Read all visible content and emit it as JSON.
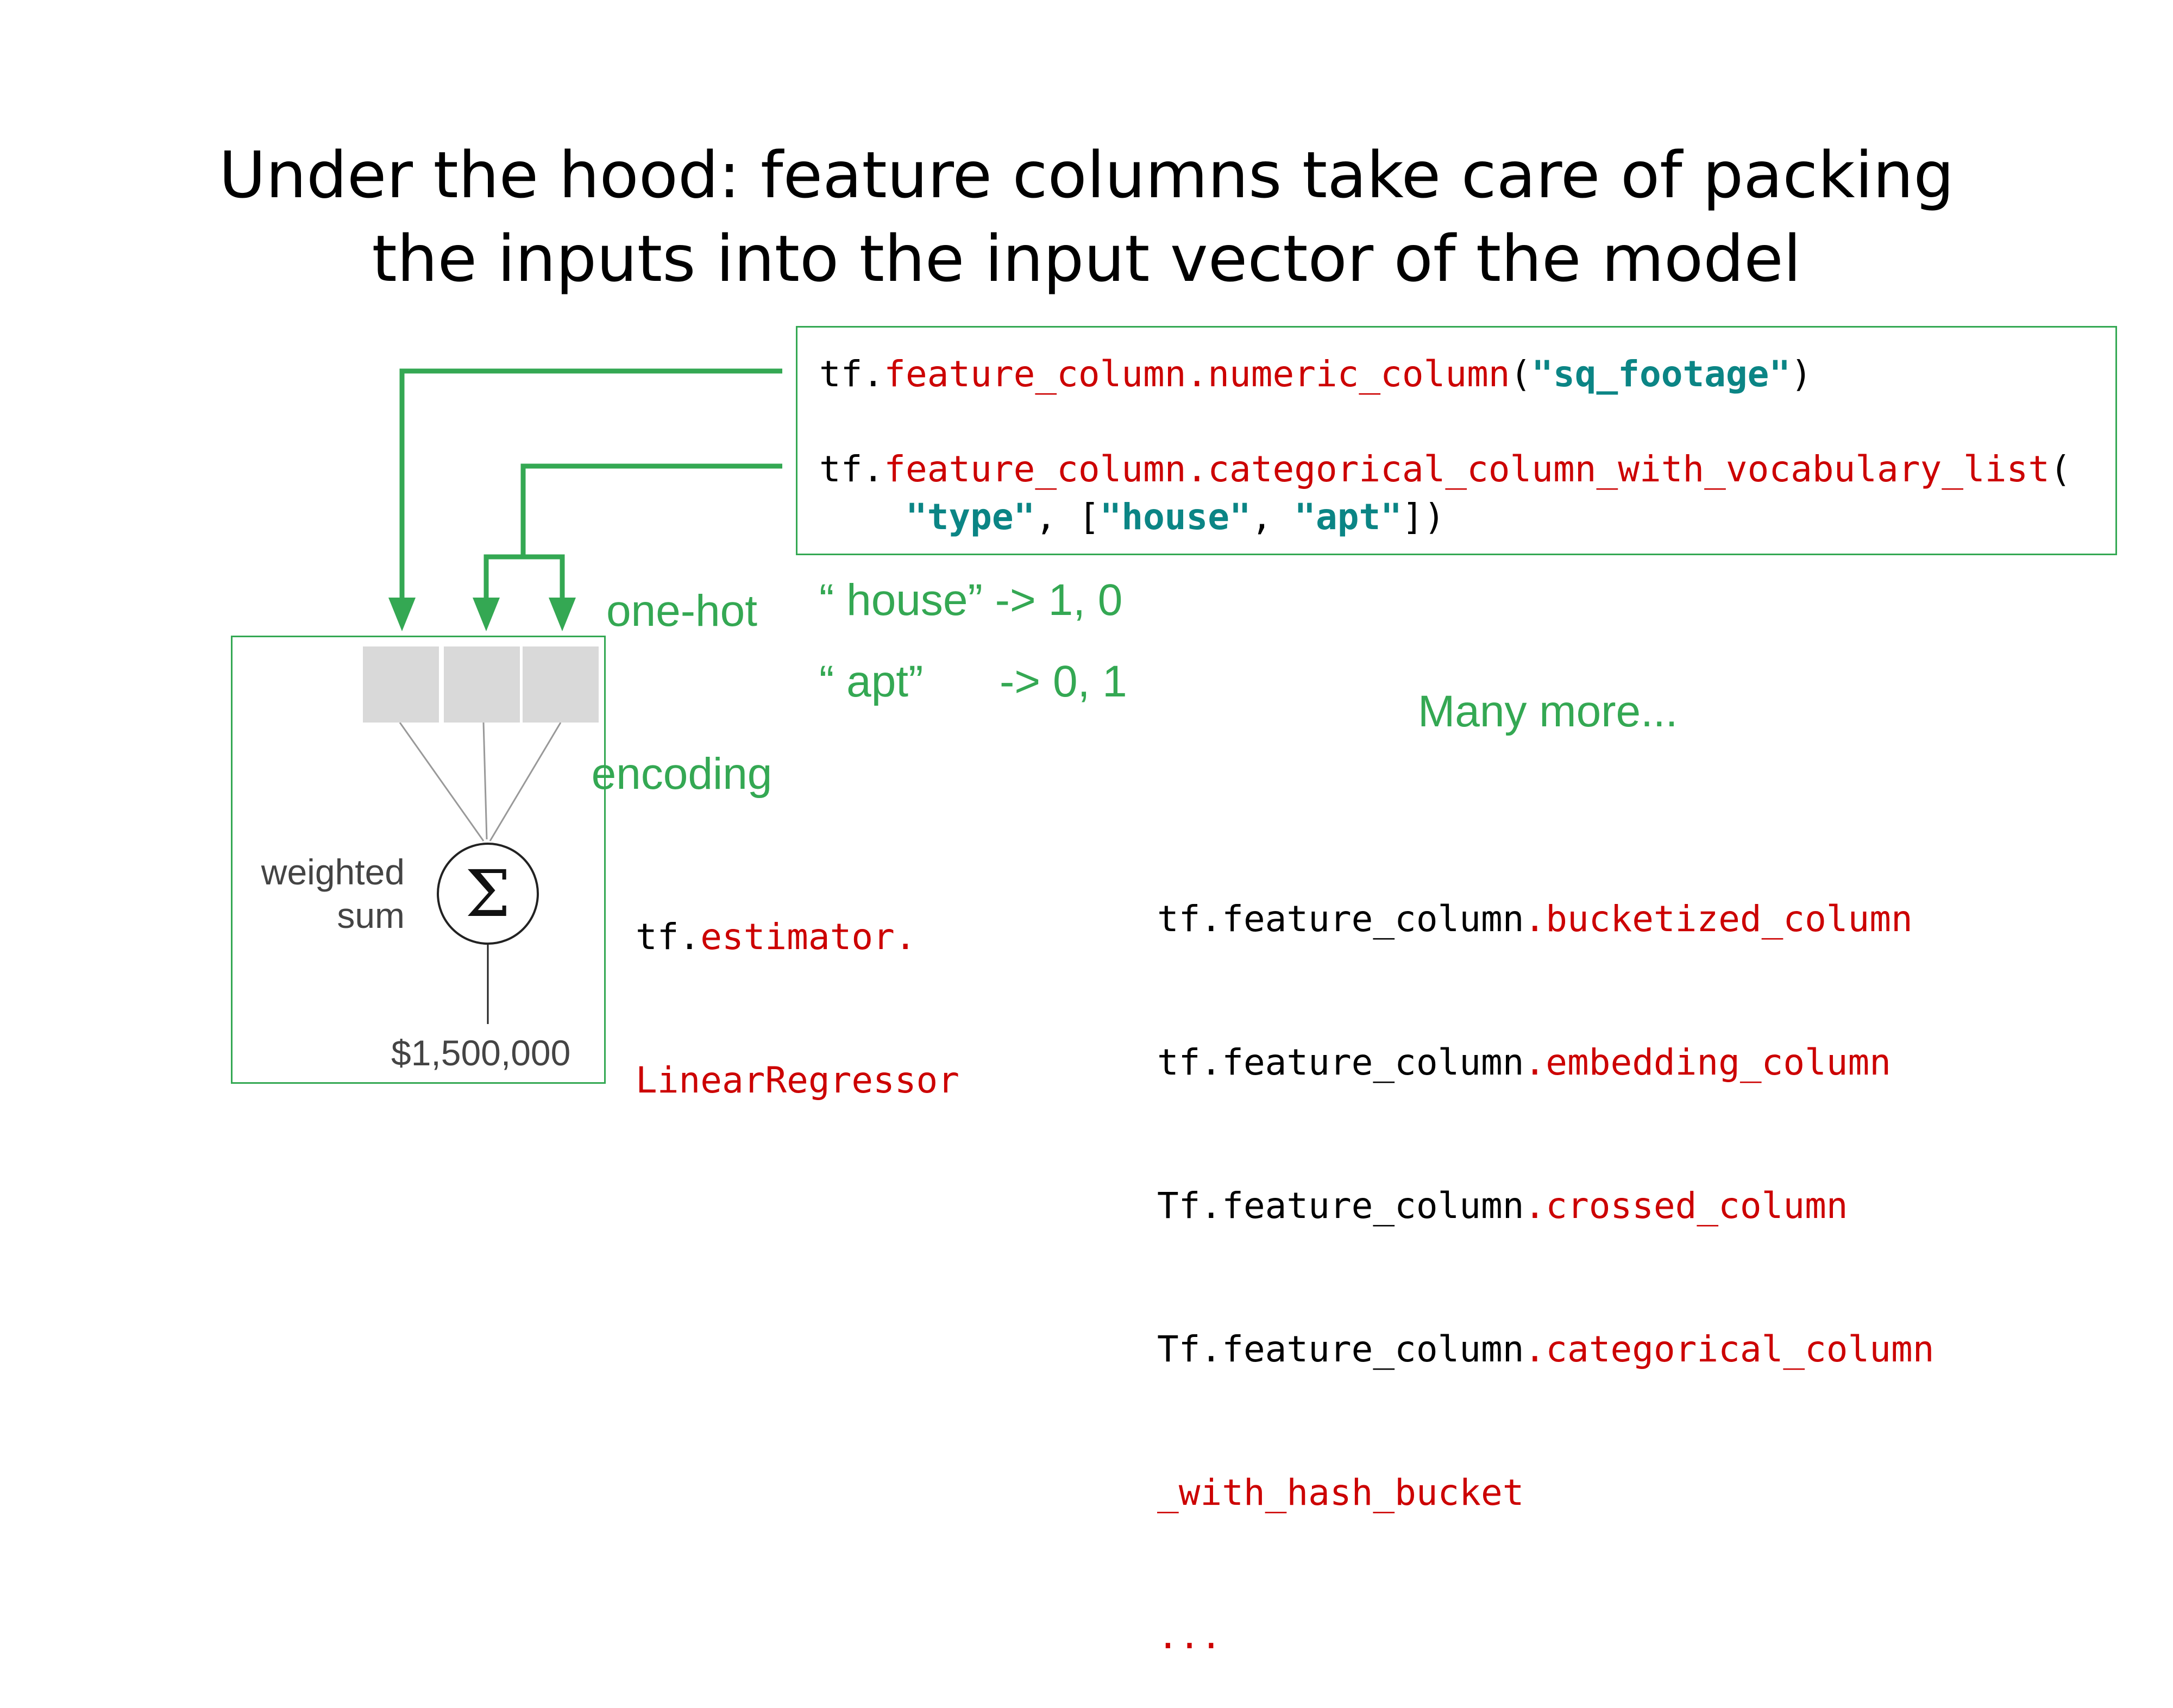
{
  "title": {
    "line1": "Under the hood: feature columns take care of packing",
    "line2": "the inputs into the input vector of the model"
  },
  "code_box": {
    "line1": {
      "prefix": "tf.",
      "func": "feature_column.numeric_column",
      "open": "(",
      "arg": "\"sq_footage\"",
      "close": ")"
    },
    "line2": {
      "prefix": "tf.",
      "func": "feature_column.categorical_column_with_vocabulary_list",
      "open": "("
    },
    "line3": {
      "indent": "    ",
      "arg1": "\"type\"",
      "sep1": ", [",
      "arg2": "\"house\"",
      "sep2": ", ",
      "arg3": "\"apt\"",
      "close": "])"
    }
  },
  "encoding": {
    "label_line1": "one-hot",
    "label_line2": "encoding",
    "house": "“ house” -> 1, 0",
    "apt_key": "“ apt”",
    "apt_val": "-> 0, 1"
  },
  "model": {
    "weighted_line1": "weighted",
    "weighted_line2": "sum",
    "sigma": "Σ",
    "output": "$1,500,000"
  },
  "estimator": {
    "line1_prefix": "tf.",
    "line1_red": "estimator.",
    "line2_red": "LinearRegressor"
  },
  "many_more": {
    "heading": "Many more...",
    "items": [
      {
        "black": "tf.feature_column",
        "red": ".bucketized_column"
      },
      {
        "black": "tf.feature_column",
        "red": ".embedding_column"
      },
      {
        "black": "Tf.feature_column",
        "red": ".crossed_column"
      },
      {
        "black": "Tf.feature_column",
        "red": ".categorical_column"
      }
    ],
    "continuation": "_with_hash_bucket",
    "ellipsis": "..."
  },
  "colors": {
    "green": "#34a853",
    "red": "#cc0000",
    "teal": "#0b8585",
    "cell_gray": "#d9d9d9"
  }
}
